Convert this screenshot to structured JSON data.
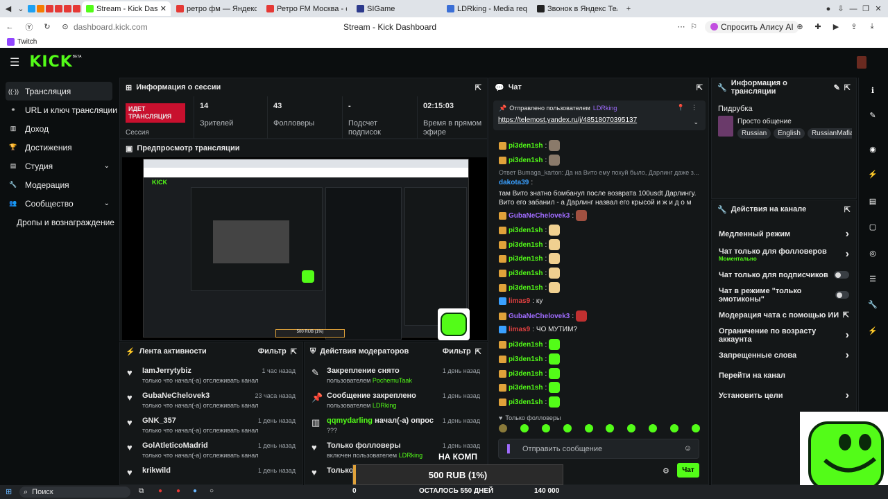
{
  "browser": {
    "tabs": [
      {
        "label": "Stream - Kick Dashb",
        "active": true,
        "color": "#53fc18"
      },
      {
        "label": "ретро фм — Яндекс: наш",
        "color": "#e53935"
      },
      {
        "label": "Ретро FM Москва - слуш",
        "color": "#e53935"
      },
      {
        "label": "SIGame",
        "color": "#2d3a8c"
      },
      {
        "label": "LDRking - Media req",
        "color": "#3b6fd6"
      },
      {
        "label": "Звонок в Яндекс Телемос",
        "color": "#222"
      }
    ],
    "url": "dashboard.kick.com",
    "page_title": "Stream - Kick Dashboard",
    "alice": "Спросить Алису AI",
    "bookmark": "Twitch"
  },
  "kick": {
    "logo": "KICK",
    "beta": "BETA"
  },
  "sidebar": {
    "items": [
      {
        "label": "Трансляция",
        "icon": "broadcast-icon",
        "active": true
      },
      {
        "label": "URL и ключ трансляции",
        "icon": "link-icon"
      },
      {
        "label": "Доход",
        "icon": "chart-icon"
      },
      {
        "label": "Достижения",
        "icon": "trophy-icon"
      },
      {
        "label": "Студия",
        "icon": "studio-icon",
        "expand": true
      },
      {
        "label": "Модерация",
        "icon": "wrench-icon"
      },
      {
        "label": "Сообщество",
        "icon": "community-icon",
        "expand": true
      },
      {
        "label": "Дропы и вознаграждение",
        "icon": ""
      }
    ]
  },
  "session": {
    "title": "Информация о сессии",
    "live": "ИДЕТ ТРАНСЛЯЦИЯ",
    "session_label": "Сессия",
    "stats": [
      {
        "value": "14",
        "label": "Зрителей"
      },
      {
        "value": "43",
        "label": "Фолловеры"
      },
      {
        "value": "-",
        "label": "Подсчет подписок"
      },
      {
        "value": "02:15:03",
        "label": "Время в прямом эфире"
      }
    ]
  },
  "preview": {
    "title": "Предпросмотр трансляции"
  },
  "activity": {
    "title": "Лента активности",
    "filter": "Фильтр",
    "items": [
      {
        "name": "IamJerrytybiz",
        "desc": "только что начал(-а) отслеживать канал",
        "time": "1 час назад"
      },
      {
        "name": "GubaNeChelovek3",
        "desc": "только что начал(-а) отслеживать канал",
        "time": "23 часа назад"
      },
      {
        "name": "GNK_357",
        "desc": "только что начал(-а) отслеживать канал",
        "time": "1 день назад"
      },
      {
        "name": "GolAtleticoMadrid",
        "desc": "только что начал(-а) отслеживать канал",
        "time": "1 день назад"
      },
      {
        "name": "krikwild",
        "desc": "",
        "time": "1 день назад"
      }
    ]
  },
  "modactions": {
    "title": "Действия модераторов",
    "filter": "Фильтр",
    "items": [
      {
        "title": "Закрепление снято",
        "by": "пользователем",
        "user": "PochemuTaak",
        "time": "1 день назад",
        "icon": "unpin-icon"
      },
      {
        "title": "Сообщение закреплено",
        "by": "пользователем",
        "user": "LDRking",
        "time": "1 день назад",
        "icon": "pin-icon"
      },
      {
        "title": "начал(-а) опрос",
        "user": "qqmydarling",
        "sub": "???",
        "time": "1 день назад",
        "icon": "poll-icon"
      },
      {
        "title": "Только фолловеры",
        "by": "включен пользователем",
        "user": "LDRking",
        "time": "1 день назад",
        "icon": "heart-icon"
      },
      {
        "title": "Только",
        "time": "1 день назад",
        "icon": "heart-icon"
      }
    ]
  },
  "chat": {
    "title": "Чат",
    "pinned_label": "Отправлено пользователем",
    "pinned_user": "LDRking",
    "pinned_link": "https://telemost.yandex.ru/j/48518070395137",
    "lines": [
      {
        "user": "pi3den1sh",
        "color": "#53fc18",
        "msg": "",
        "emote": "#8a7a6a"
      },
      {
        "user": "pi3den1sh",
        "color": "#53fc18",
        "msg": "",
        "emote": "#8a7a6a"
      },
      {
        "reply": "Ответ Bumaga_karton: Да на Вито ему похуй было, Даpлинг даже з..."
      },
      {
        "user": "dakota39",
        "color": "#3aa0ff",
        "msg": "там Вито знатно бомбанул после возврата 100usdt Дарлингу. Вито его забанил - а Даpлинг назвал его крысой и ж и д о м"
      },
      {
        "user": "GubaNeChelovek3",
        "color": "#a06cff",
        "msg": "",
        "emote": "#a05040"
      },
      {
        "user": "pi3den1sh",
        "color": "#53fc18",
        "msg": "",
        "emote": "#f0d090"
      },
      {
        "user": "pi3den1sh",
        "color": "#53fc18",
        "msg": "",
        "emote": "#f0d090"
      },
      {
        "user": "pi3den1sh",
        "color": "#53fc18",
        "msg": "",
        "emote": "#f0d090"
      },
      {
        "user": "pi3den1sh",
        "color": "#53fc18",
        "msg": "",
        "emote": "#f0d090"
      },
      {
        "user": "pi3den1sh",
        "color": "#53fc18",
        "msg": "",
        "emote": "#f0d090"
      },
      {
        "user": "limas9",
        "color": "#e04040",
        "msg": "ку"
      },
      {
        "user": "GubaNeChelovek3",
        "color": "#a06cff",
        "msg": "",
        "emote": "#c03030"
      },
      {
        "user": "limas9",
        "color": "#e04040",
        "msg": "ЧО МУТИМ?"
      },
      {
        "user": "pi3den1sh",
        "color": "#53fc18",
        "msg": "",
        "emote": "#53fc18"
      },
      {
        "user": "pi3den1sh",
        "color": "#53fc18",
        "msg": "",
        "emote": "#53fc18"
      },
      {
        "user": "pi3den1sh",
        "color": "#53fc18",
        "msg": "",
        "emote": "#53fc18"
      },
      {
        "user": "pi3den1sh",
        "color": "#53fc18",
        "msg": "",
        "emote": "#53fc18"
      },
      {
        "user": "pi3den1sh",
        "color": "#53fc18",
        "msg": "",
        "emote": "#53fc18"
      }
    ],
    "followers_only": "Только фолловеры",
    "placeholder": "Отправить сообщение",
    "send": "Чат"
  },
  "streaminfo": {
    "title": "Информация о трансляции",
    "category": "Пидрубка",
    "stream_title": "Просто общение",
    "tags": [
      "Russian",
      "English",
      "RussianMafia"
    ]
  },
  "channel": {
    "title": "Действия на канале",
    "items": [
      {
        "label": "Медленный режим",
        "type": "arrow"
      },
      {
        "label": "Чат только для фолловеров",
        "sub": "Моментально",
        "type": "arrow"
      },
      {
        "label": "Чат только для подписчиков",
        "type": "toggle"
      },
      {
        "label": "Чат в режиме \"только эмотиконы\"",
        "type": "toggle"
      },
      {
        "label": "Модерация чата с помощью ИИ",
        "type": "ext"
      },
      {
        "label": "Ограничение по возрасту аккаунта",
        "type": "arrow"
      },
      {
        "label": "Запрещенные слова",
        "type": "arrow"
      },
      {
        "label": "Перейти на канал",
        "type": "none"
      },
      {
        "label": "Установить цели",
        "type": "arrow"
      }
    ]
  },
  "overlay": {
    "goal": "500 RUB (1%)",
    "left": "0",
    "remaining": "ОСТАЛОСЬ 550 ДНЕЙ",
    "target": "140 000",
    "banner": "НА КОМП"
  },
  "taskbar": {
    "search": "Поиск"
  }
}
